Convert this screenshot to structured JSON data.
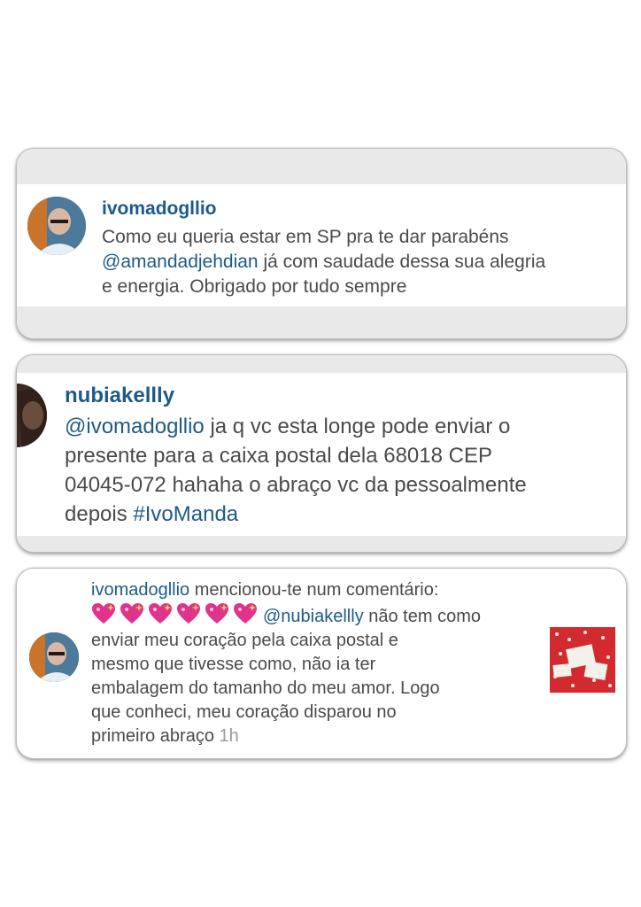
{
  "colors": {
    "link": "#1d5a88",
    "text": "#4a4a4a",
    "muted": "#9a9a9a",
    "band": "#e9e9ea",
    "heart": "#e0338c"
  },
  "comments": [
    {
      "username": "ivomadogllio",
      "lines": [
        {
          "text": "Como eu queria estar em SP pra te dar parabéns"
        },
        {
          "mention": "@amandadjehdian",
          "text": " já com saudade dessa sua alegria"
        },
        {
          "text": "e energia. Obrigado por tudo sempre"
        }
      ]
    },
    {
      "username": "nubiakellly",
      "lines": [
        {
          "mention": "@ivomadogllio",
          "text": " ja q vc esta longe pode enviar o"
        },
        {
          "text": "presente para a caixa postal dela 68018 CEP"
        },
        {
          "text": "04045-072 hahaha o abraço vc da pessoalmente"
        },
        {
          "text": "depois ",
          "hashtag": "#IvoManda"
        }
      ]
    }
  ],
  "notification": {
    "username": "ivomadogllio",
    "action": " mencionou-te num comentário:",
    "heart_icon": "sparkling-heart-icon",
    "heart_count": 6,
    "mention": "@nubiakellly",
    "mention_tail": " não tem como",
    "lines": [
      "enviar meu coração pela caixa postal e",
      "mesmo que tivesse como, não ia ter",
      "embalagem do tamanho do meu amor. Logo",
      "que conheci, meu coração disparou no"
    ],
    "last_line": "primeiro abraço",
    "time": "1h"
  }
}
